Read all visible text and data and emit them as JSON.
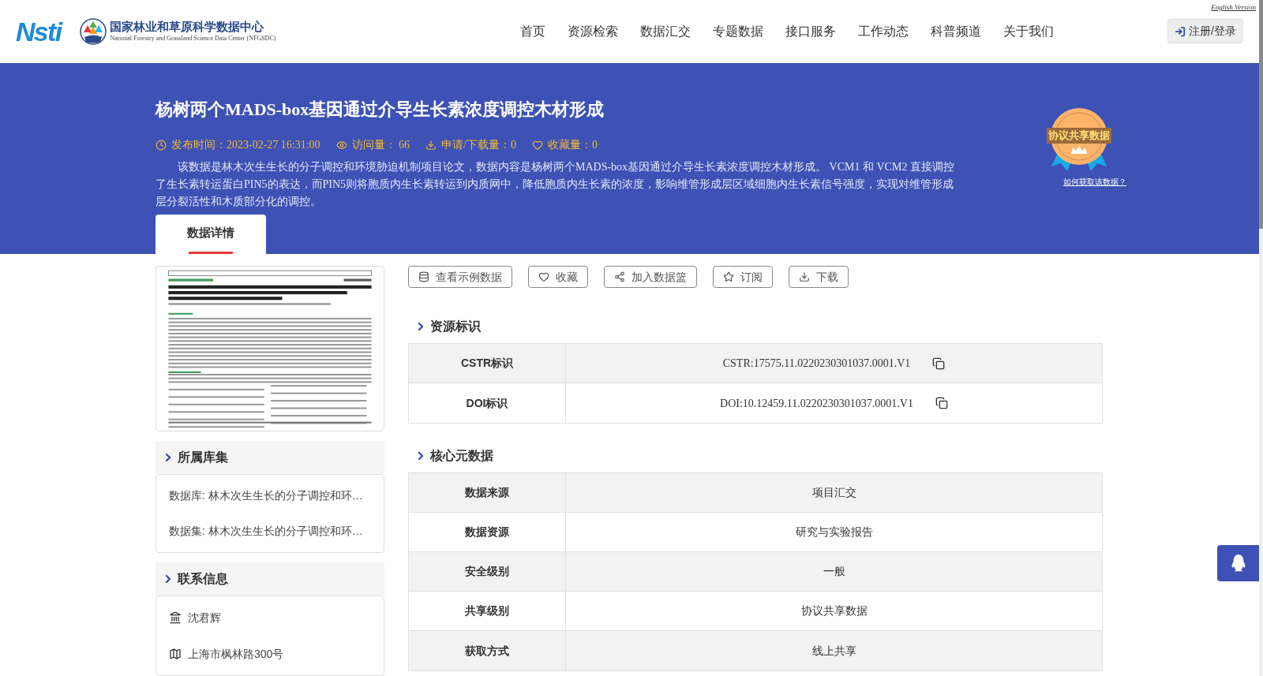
{
  "header": {
    "logo_text": "Nsti",
    "site_name": "国家林业和草原科学数据中心",
    "site_name_en": "National Forestry and Grassland Science Data Center (NFGSDC)",
    "english_link": "English Version",
    "login_button": "注册/登录",
    "nav": [
      {
        "label": "首页",
        "selected": false
      },
      {
        "label": "资源检索",
        "selected": false
      },
      {
        "label": "数据汇交",
        "selected": false
      },
      {
        "label": "专题数据",
        "selected": false
      },
      {
        "label": "接口服务",
        "selected": false
      },
      {
        "label": "工作动态",
        "selected": false
      },
      {
        "label": "科普频道",
        "selected": false
      },
      {
        "label": "关于我们",
        "selected": false
      }
    ]
  },
  "banner": {
    "title": "杨树两个MADS-box基因通过介导生长素浓度调控木材形成",
    "meta": [
      {
        "kind": "time",
        "text": "发布时间：2023-02-27 16:31:00"
      },
      {
        "kind": "views",
        "text": "访问量： 66"
      },
      {
        "kind": "downloads",
        "text": "申请/下载量：0"
      },
      {
        "kind": "favorites",
        "text": "收藏量：0"
      }
    ],
    "description": "该数据是林木次生生长的分子调控和环境胁迫机制项目论文，数据内容是杨树两个MADS-box基因通过介导生长素浓度调控木材形成。 VCM1 和 VCM2 直接调控了生长素转运蛋白PIN5的表达，而PIN5则将胞质内生长素转运到内质网中，降低胞质内生长素的浓度，影响维管形成层区域细胞内生长素信号强度，实现对维管形成层分裂活性和木质部分化的调控。",
    "badge": {
      "text": "协议共享数据",
      "link": "如何获取该数据？"
    },
    "tabs": [
      {
        "label": "数据详情",
        "selected": true
      }
    ]
  },
  "sidebar": {
    "collections": {
      "title": "所属库集",
      "items": [
        "数据库: 林木次生生长的分子调控和环…",
        "数据集: 林木次生生长的分子调控和环…"
      ]
    },
    "contact": {
      "title": "联系信息",
      "items": [
        {
          "kind": "institution",
          "text": "沈君辉"
        },
        {
          "kind": "address",
          "text": "上海市枫林路300号"
        }
      ]
    }
  },
  "actions": [
    {
      "kind": "database",
      "label": "查看示例数据"
    },
    {
      "kind": "heart",
      "label": "收藏"
    },
    {
      "kind": "share",
      "label": "加入数据篮"
    },
    {
      "kind": "star",
      "label": "订阅"
    },
    {
      "kind": "download",
      "label": "下载"
    }
  ],
  "identifiers": {
    "title": "资源标识",
    "rows": [
      {
        "label": "CSTR标识",
        "value": "CSTR:17575.11.0220230301037.0001.V1"
      },
      {
        "label": "DOI标识",
        "value": "DOI:10.12459.11.0220230301037.0001.V1"
      }
    ]
  },
  "core_metadata": {
    "title": "核心元数据",
    "rows": [
      {
        "label": "数据来源",
        "value": "项目汇交"
      },
      {
        "label": "数据资源",
        "value": "研究与实验报告"
      },
      {
        "label": "安全级别",
        "value": "一般"
      },
      {
        "label": "共享级别",
        "value": "协议共享数据"
      },
      {
        "label": "获取方式",
        "value": "线上共享"
      }
    ]
  }
}
